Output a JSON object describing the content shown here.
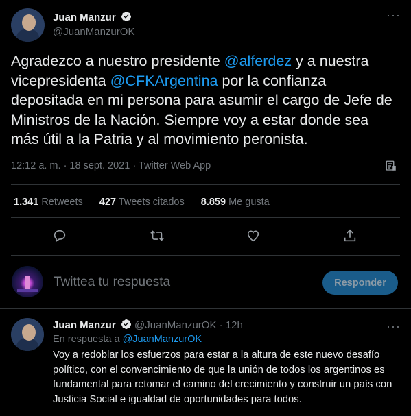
{
  "main": {
    "author_name": "Juan Manzur",
    "author_handle": "@JuanManzurOK",
    "text_part1": "Agradezco a nuestro presidente ",
    "mention1": "@alferdez",
    "text_part2": " y a nuestra vicepresidenta ",
    "mention2": "@CFKArgentina",
    "text_part3": " por la confianza depositada en mi persona para asumir el cargo de Jefe de Ministros de la Nación. Siempre voy a estar donde sea más útil a la Patria y al movimiento peronista.",
    "meta": "12:12 a. m. · 18 sept. 2021 · Twitter Web App",
    "stats": {
      "retweets_count": "1.341",
      "retweets_label": "Retweets",
      "quotes_count": "427",
      "quotes_label": "Tweets citados",
      "likes_count": "8.859",
      "likes_label": "Me gusta"
    }
  },
  "compose": {
    "placeholder": "Twittea tu respuesta",
    "button_label": "Responder"
  },
  "reply": {
    "author_name": "Juan Manzur",
    "author_handle": "@JuanManzurOK",
    "time": "· 12h",
    "in_reply_prefix": "En respuesta a ",
    "in_reply_handle": "@JuanManzurOK",
    "text": "Voy a redoblar los esfuerzos para estar a la altura de este nuevo desafío político, con el convencimiento de que la unión de todos los argentinos es fundamental para retomar el camino del crecimiento y construir un país con Justicia Social e igualdad de oportunidades para todos."
  },
  "icons": {
    "verified": "verified-badge-icon",
    "more": "more-options-icon",
    "analytics": "analytics-icon",
    "reply": "reply-icon",
    "retweet": "retweet-icon",
    "like": "heart-icon",
    "share": "share-icon"
  },
  "colors": {
    "background": "#000000",
    "accent": "#1d9bf0",
    "muted": "#71767b",
    "text": "#e7e9ea"
  }
}
